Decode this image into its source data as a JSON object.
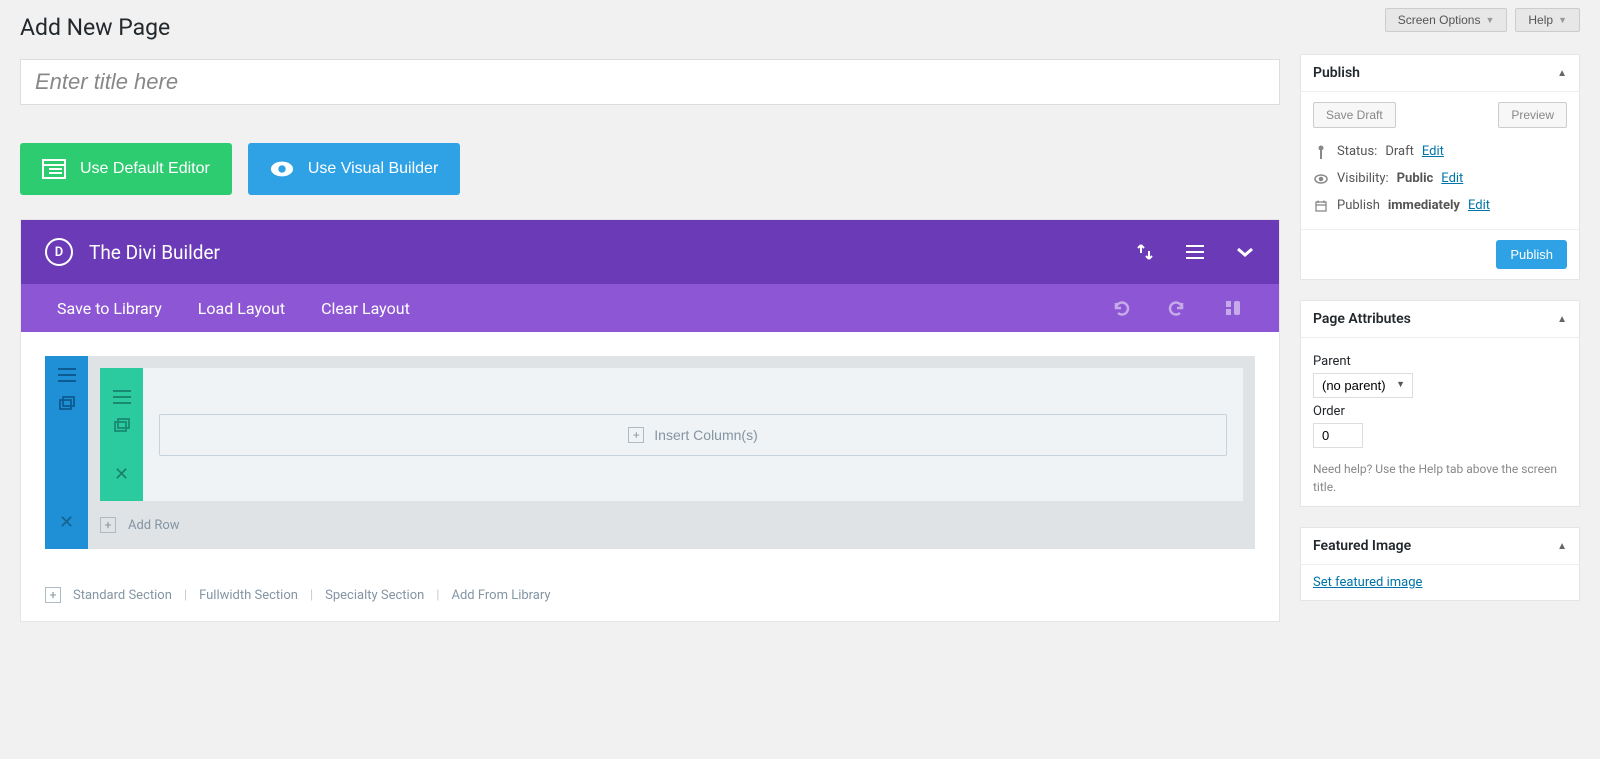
{
  "topbar": {
    "screen_options": "Screen Options",
    "help": "Help"
  },
  "page": {
    "title": "Add New Page"
  },
  "title_input": {
    "placeholder": "Enter title here",
    "value": ""
  },
  "builder_buttons": {
    "default_editor": "Use Default Editor",
    "visual_builder": "Use Visual Builder"
  },
  "divi": {
    "title": "The Divi Builder",
    "save_to_library": "Save to Library",
    "load_layout": "Load Layout",
    "clear_layout": "Clear Layout",
    "insert_columns": "Insert Column(s)",
    "add_row": "Add Row",
    "sections": {
      "standard": "Standard Section",
      "fullwidth": "Fullwidth Section",
      "specialty": "Specialty Section",
      "from_library": "Add From Library"
    }
  },
  "publish": {
    "heading": "Publish",
    "save_draft": "Save Draft",
    "preview": "Preview",
    "status_label": "Status:",
    "status_value": "Draft",
    "visibility_label": "Visibility:",
    "visibility_value": "Public",
    "publish_label": "Publish",
    "publish_value": "immediately",
    "edit": "Edit",
    "publish_btn": "Publish"
  },
  "page_attributes": {
    "heading": "Page Attributes",
    "parent_label": "Parent",
    "parent_value": "(no parent)",
    "order_label": "Order",
    "order_value": "0",
    "help": "Need help? Use the Help tab above the screen title."
  },
  "featured_image": {
    "heading": "Featured Image",
    "set": "Set featured image"
  }
}
